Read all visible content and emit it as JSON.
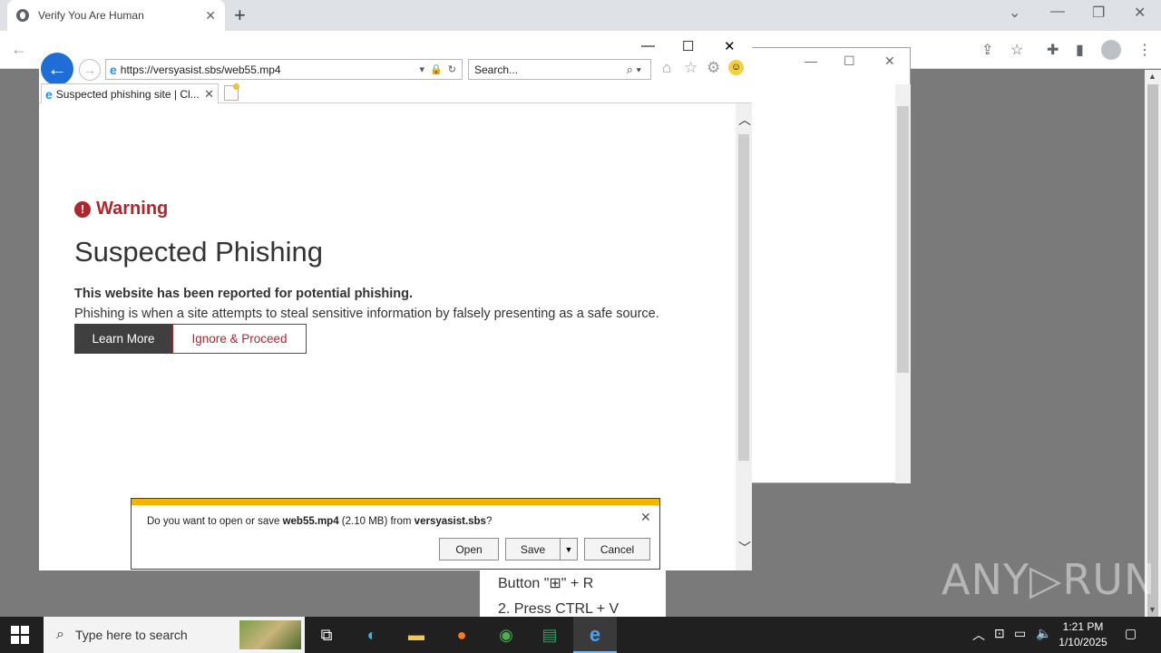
{
  "chrome": {
    "tab_title": "Verify You Are Human",
    "tab_close": "✕",
    "new_tab": "+"
  },
  "ie": {
    "address_url": "https://versyasist.sbs/web55.mp4",
    "search_placeholder": "Search...",
    "tab_title": "Suspected phishing site | Cl...",
    "tab_close": "✕"
  },
  "warning_page": {
    "warning_label": "Warning",
    "title": "Suspected Phishing",
    "lead_bold": "This website has been reported for potential phishing.",
    "lead_text": "Phishing is when a site attempts to steal sensitive information by falsely presenting as a safe source.",
    "learn_more": "Learn More",
    "ignore_proceed": "Ignore & Proceed"
  },
  "download": {
    "msg_prefix": "Do you want to open or save ",
    "file_name": "web55.mp4",
    "file_size": " (2.10 MB) from ",
    "site": "versyasist.sbs",
    "msg_suffix": "?",
    "open": "Open",
    "save": "Save",
    "cancel": "Cancel"
  },
  "instructions": {
    "line1": "Button \"⊞\" + R",
    "line2": "2. Press CTRL + V"
  },
  "watermark": "ANY▷RUN",
  "taskbar": {
    "search_placeholder": "Type here to search",
    "time": "1:21 PM",
    "date": "1/10/2025"
  },
  "colors": {
    "warning_red": "#b0262d",
    "download_accent": "#f3b400",
    "ie_blue": "#1e6ed6"
  }
}
